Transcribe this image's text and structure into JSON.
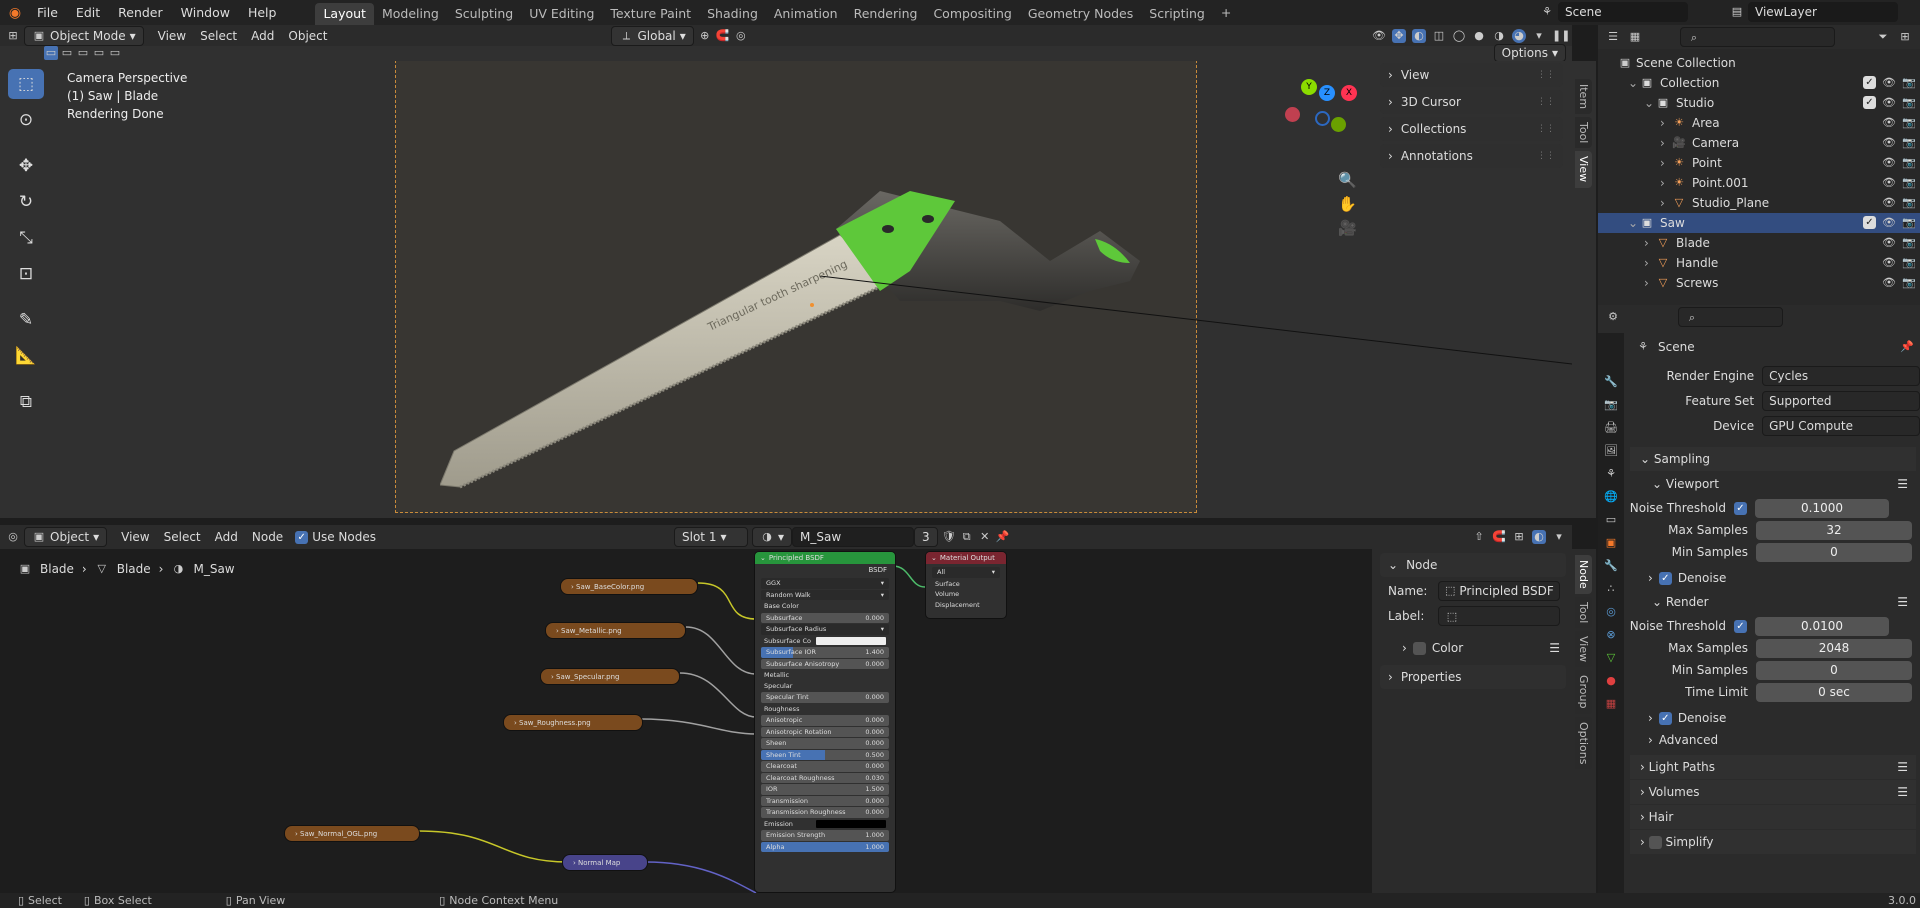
{
  "topbar": {
    "menus": [
      "File",
      "Edit",
      "Render",
      "Window",
      "Help"
    ],
    "workspaces": [
      "Layout",
      "Modeling",
      "Sculpting",
      "UV Editing",
      "Texture Paint",
      "Shading",
      "Animation",
      "Rendering",
      "Compositing",
      "Geometry Nodes",
      "Scripting"
    ],
    "active_workspace": "Layout",
    "add_tab": "+",
    "scene_name": "Scene",
    "view_layer": "ViewLayer"
  },
  "viewport_header": {
    "mode": "Object Mode",
    "menus": [
      "View",
      "Select",
      "Add",
      "Object"
    ],
    "transform_orientation": "Global",
    "options_label": "Options"
  },
  "viewport": {
    "overlay_lines": [
      "Camera Perspective",
      "(1) Saw | Blade",
      "Rendering Done"
    ],
    "blade_engraving": "Triangular tooth sharpening",
    "npanel": {
      "items": [
        "View",
        "3D Cursor",
        "Collections",
        "Annotations"
      ],
      "tabs": [
        "Item",
        "Tool",
        "View"
      ]
    },
    "gizmo_axes": [
      "X",
      "Y",
      "Z"
    ]
  },
  "outliner": {
    "root": "Scene Collection",
    "rows": [
      {
        "label": "Collection",
        "indent": 1
      },
      {
        "label": "Studio",
        "indent": 2
      },
      {
        "label": "Area",
        "indent": 3
      },
      {
        "label": "Camera",
        "indent": 3
      },
      {
        "label": "Point",
        "indent": 3
      },
      {
        "label": "Point.001",
        "indent": 3
      },
      {
        "label": "Studio_Plane",
        "indent": 3
      },
      {
        "label": "Saw",
        "indent": 1
      },
      {
        "label": "Blade",
        "indent": 2
      },
      {
        "label": "Handle",
        "indent": 2
      },
      {
        "label": "Screws",
        "indent": 2
      }
    ],
    "selected": "Saw"
  },
  "properties": {
    "context": "Scene",
    "render_engine_label": "Render Engine",
    "render_engine": "Cycles",
    "feature_set_label": "Feature Set",
    "feature_set": "Supported",
    "device_label": "Device",
    "device": "GPU Compute",
    "sampling": "Sampling",
    "viewport": "Viewport",
    "vp_noise_label": "Noise Threshold",
    "vp_noise": "0.1000",
    "vp_max_label": "Max Samples",
    "vp_max": "32",
    "vp_min_label": "Min Samples",
    "vp_min": "0",
    "denoise": "Denoise",
    "render": "Render",
    "r_noise_label": "Noise Threshold",
    "r_noise": "0.0100",
    "r_max_label": "Max Samples",
    "r_max": "2048",
    "r_min_label": "Min Samples",
    "r_min": "0",
    "r_time_label": "Time Limit",
    "r_time": "0 sec",
    "denoise2": "Denoise",
    "advanced": "Advanced",
    "light_paths": "Light Paths",
    "volumes": "Volumes",
    "hair": "Hair",
    "simplify": "Simplify",
    "version": "3.0.0"
  },
  "node_editor": {
    "header": {
      "type": "Object",
      "menus": [
        "View",
        "Select",
        "Add",
        "Node"
      ],
      "use_nodes": "Use Nodes",
      "slot": "Slot 1",
      "material": "M_Saw",
      "users": "3"
    },
    "breadcrumb": [
      "Blade",
      "Blade",
      "M_Saw"
    ],
    "textures": [
      "Saw_BaseColor.png",
      "Saw_Metallic.png",
      "Saw_Specular.png",
      "Saw_Roughness.png",
      "Saw_Normal_OGL.png"
    ],
    "normal_map": "Normal Map",
    "bsdf": {
      "title": "Principled BSDF",
      "output_label": "BSDF",
      "distribution": "GGX",
      "subsurface_method": "Random Walk",
      "rows": [
        {
          "k": "Base Color",
          "v": "",
          "t": "s"
        },
        {
          "k": "Subsurface",
          "v": "0.000",
          "t": "f"
        },
        {
          "k": "Subsurface Radius",
          "v": "",
          "t": "d"
        },
        {
          "k": "Subsurface Co",
          "v": "",
          "t": "c"
        },
        {
          "k": "Subsurface IOR",
          "v": "1.400",
          "t": "f"
        },
        {
          "k": "Subsurface Anisotropy",
          "v": "0.000",
          "t": "f"
        },
        {
          "k": "Metallic",
          "v": "",
          "t": "s"
        },
        {
          "k": "Specular",
          "v": "",
          "t": "s"
        },
        {
          "k": "Specular Tint",
          "v": "0.000",
          "t": "f"
        },
        {
          "k": "Roughness",
          "v": "",
          "t": "s"
        },
        {
          "k": "Anisotropic",
          "v": "0.000",
          "t": "f"
        },
        {
          "k": "Anisotropic Rotation",
          "v": "0.000",
          "t": "f"
        },
        {
          "k": "Sheen",
          "v": "0.000",
          "t": "f"
        },
        {
          "k": "Sheen Tint",
          "v": "0.500",
          "t": "f"
        },
        {
          "k": "Clearcoat",
          "v": "0.000",
          "t": "f"
        },
        {
          "k": "Clearcoat Roughness",
          "v": "0.030",
          "t": "f"
        },
        {
          "k": "IOR",
          "v": "1.500",
          "t": "f"
        },
        {
          "k": "Transmission",
          "v": "0.000",
          "t": "f"
        },
        {
          "k": "Transmission Roughness",
          "v": "0.000",
          "t": "f"
        },
        {
          "k": "Emission",
          "v": "",
          "t": "k"
        },
        {
          "k": "Emission Strength",
          "v": "1.000",
          "t": "f"
        },
        {
          "k": "Alpha",
          "v": "1.000",
          "t": "f"
        }
      ]
    },
    "material_output": {
      "title": "Material Output",
      "target": "All",
      "sockets": [
        "Surface",
        "Volume",
        "Displacement"
      ]
    },
    "side_panel": {
      "node_section": "Node",
      "name_label": "Name:",
      "name_value": "Principled BSDF",
      "label_label": "Label:",
      "color": "Color",
      "properties": "Properties",
      "tabs": [
        "Node",
        "Tool",
        "View",
        "Group",
        "Options"
      ]
    }
  },
  "statusbar": {
    "select": "Select",
    "box_select": "Box Select",
    "pan_view": "Pan View",
    "context_menu": "Node Context Menu"
  }
}
